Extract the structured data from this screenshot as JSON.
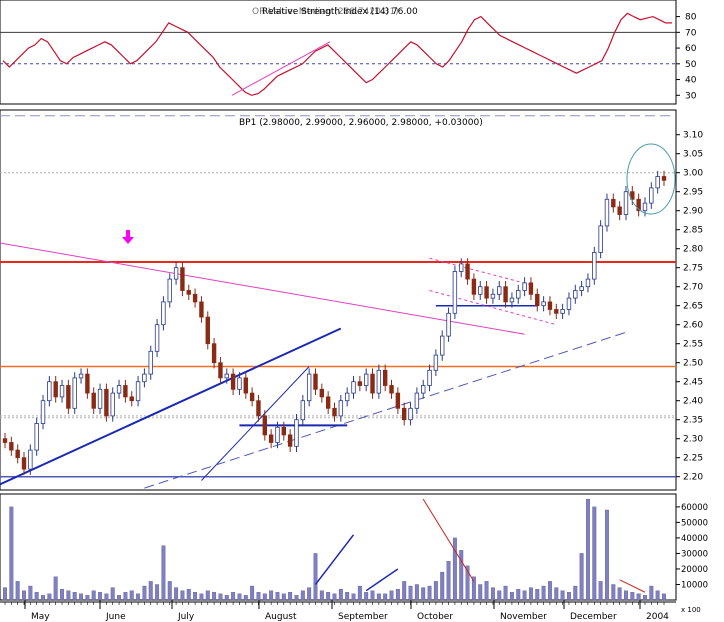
{
  "chart_data": [
    {
      "type": "line",
      "panel": "indicator",
      "title": "Relative Strength Index (14) 76.00",
      "overlay_title": "OR Value: Median (288.7420.31)",
      "y_ticks": [
        "30",
        "40",
        "50",
        "60",
        "70",
        "80"
      ],
      "ylim": [
        27,
        88
      ],
      "reference_lines": [
        70,
        50
      ],
      "values": [
        52,
        48,
        52,
        56,
        60,
        62,
        66,
        64,
        58,
        52,
        50,
        54,
        56,
        58,
        60,
        62,
        64,
        62,
        58,
        54,
        50,
        52,
        56,
        60,
        64,
        70,
        76,
        74,
        72,
        70,
        66,
        62,
        58,
        54,
        48,
        44,
        40,
        36,
        32,
        30,
        31,
        34,
        38,
        42,
        44,
        46,
        48,
        50,
        54,
        58,
        60,
        62,
        58,
        54,
        50,
        46,
        42,
        38,
        40,
        44,
        48,
        52,
        56,
        60,
        64,
        62,
        58,
        54,
        50,
        48,
        52,
        58,
        64,
        72,
        78,
        80,
        76,
        72,
        68,
        66,
        64,
        62,
        60,
        58,
        56,
        54,
        52,
        50,
        48,
        46,
        44,
        46,
        48,
        50,
        52,
        60,
        70,
        78,
        82,
        80,
        78,
        79,
        80,
        78,
        76,
        76
      ]
    },
    {
      "type": "candlestick",
      "panel": "price",
      "title": "BP1 (2.98000, 2.99000, 2.96000, 2.98000, +0.03000)",
      "y_ticks": [
        "2.20",
        "2.25",
        "2.30",
        "2.35",
        "2.40",
        "2.45",
        "2.50",
        "2.55",
        "2.60",
        "2.65",
        "2.70",
        "2.75",
        "2.80",
        "2.85",
        "2.90",
        "2.95",
        "3.00",
        "3.05",
        "3.10"
      ],
      "ylim": [
        2.165,
        3.165
      ],
      "horizontal_levels": [
        {
          "value": 2.765,
          "color": "#e8281e",
          "style": "solid"
        },
        {
          "value": 2.49,
          "color": "#f07020",
          "style": "solid"
        },
        {
          "value": 2.2,
          "color": "#5058b8",
          "style": "solid"
        },
        {
          "value": 3.15,
          "color": "#9090c0",
          "style": "dashed"
        },
        {
          "value": 3.0,
          "color": "#b0b0b0",
          "style": "dotted"
        },
        {
          "value": 2.36,
          "color": "#b0b0b0",
          "style": "dotted"
        },
        {
          "value": 2.355,
          "color": "#b0b0b0",
          "style": "dotted"
        }
      ],
      "closes": [
        2.29,
        2.27,
        2.25,
        2.22,
        2.27,
        2.34,
        2.4,
        2.45,
        2.41,
        2.44,
        2.38,
        2.46,
        2.47,
        2.42,
        2.38,
        2.43,
        2.36,
        2.42,
        2.44,
        2.41,
        2.4,
        2.45,
        2.47,
        2.53,
        2.6,
        2.66,
        2.72,
        2.75,
        2.69,
        2.68,
        2.66,
        2.62,
        2.55,
        2.5,
        2.46,
        2.47,
        2.43,
        2.46,
        2.42,
        2.4,
        2.36,
        2.31,
        2.29,
        2.33,
        2.31,
        2.28,
        2.35,
        2.4,
        2.47,
        2.43,
        2.41,
        2.38,
        2.36,
        2.4,
        2.42,
        2.45,
        2.44,
        2.47,
        2.42,
        2.48,
        2.44,
        2.42,
        2.38,
        2.35,
        2.38,
        2.42,
        2.44,
        2.48,
        2.52,
        2.57,
        2.63,
        2.74,
        2.76,
        2.72,
        2.68,
        2.7,
        2.67,
        2.68,
        2.7,
        2.66,
        2.67,
        2.69,
        2.71,
        2.68,
        2.65,
        2.66,
        2.64,
        2.63,
        2.64,
        2.67,
        2.69,
        2.7,
        2.72,
        2.79,
        2.86,
        2.93,
        2.91,
        2.89,
        2.95,
        2.93,
        2.9,
        2.92,
        2.96,
        2.99,
        2.98
      ]
    },
    {
      "type": "bar",
      "panel": "volume",
      "y_ticks": [
        "10000",
        "20000",
        "30000",
        "40000",
        "50000",
        "60000"
      ],
      "ylim": [
        0,
        67000
      ],
      "y_unit_label": "x 100",
      "values": [
        8000,
        60000,
        12000,
        6000,
        9000,
        5000,
        3000,
        4000,
        15000,
        7000,
        6000,
        5000,
        4000,
        3000,
        6000,
        5000,
        4000,
        8000,
        3000,
        5000,
        6000,
        4000,
        9000,
        12000,
        10000,
        35000,
        12000,
        8000,
        6000,
        7000,
        5000,
        4000,
        6000,
        5000,
        4000,
        3000,
        5000,
        4000,
        3000,
        9000,
        5000,
        4000,
        6000,
        5000,
        4000,
        5000,
        3000,
        6000,
        8000,
        30000,
        6000,
        5000,
        4000,
        7000,
        5000,
        4000,
        9000,
        5000,
        6000,
        4000,
        4000,
        6000,
        7000,
        12000,
        9000,
        10000,
        8000,
        9000,
        12000,
        18000,
        25000,
        40000,
        32000,
        22000,
        15000,
        10000,
        12000,
        8000,
        6000,
        9000,
        5000,
        7000,
        6000,
        8000,
        7000,
        9000,
        12000,
        8000,
        6000,
        5000,
        9000,
        30000,
        65000,
        60000,
        12000,
        58000,
        10000,
        8000,
        6000,
        5000,
        4000,
        3000,
        9000,
        6000,
        4000
      ],
      "x_labels": [
        "May",
        "June",
        "July",
        "August",
        "September",
        "October",
        "November",
        "December",
        "2004"
      ]
    }
  ],
  "colors": {
    "up": "#2a3a8c",
    "down": "#8a2a14",
    "rsi_line": "#c8102e",
    "grid_blue": "#3a46a8",
    "trend_magenta": "#e040c0",
    "volume_bar": "#8080c0",
    "circle": "#4a9ab0"
  }
}
